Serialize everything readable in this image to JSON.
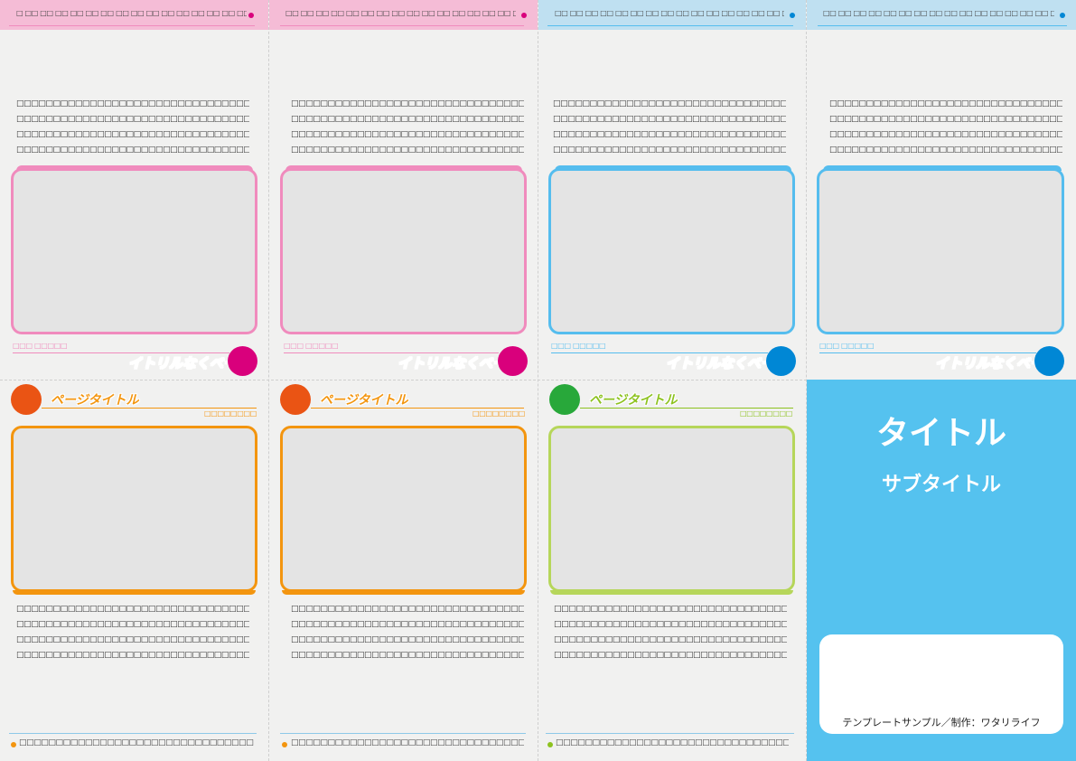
{
  "colors": {
    "pink": "#f08bbd",
    "pink_dark": "#d9007c",
    "blue": "#55bdee",
    "blue_dark": "#0087d5",
    "orange": "#f3950f",
    "orange_dark": "#ea5414",
    "green": "#b6d65a",
    "green_dark": "#28a83a",
    "cover": "#55c2ef"
  },
  "panels_top": [
    {
      "strip_text": "□ □□ □□ □□ □□ □□ □□ □□ □□ □□ □□ □□ □□ □□ □□ □□ □□ □□ □□ □□ □□",
      "para": [
        "□□□□□□□□□□□□□□□□□□□□□□□□□□□□□□□□□□□□",
        "□□□□□□□□□□□□□□□□□□□□□□□□□□□□□□□□□□□□",
        "□□□□□□□□□□□□□□□□□□□□□□□□□□□□□□□□□□□□",
        "□□□□□□□□□□□□□□□□□□□□□□□□□□□□□□□□□□□□"
      ],
      "caption": "□□□ □□□□□",
      "stylized": "イトリルなくべーし"
    },
    {
      "strip_text": "□□ □□ □□ □□ □□ □□ □□ □□ □□ □□ □□ □□ □□ □□ □□ □□ □□ □□ □□ □□",
      "para": [
        "□□□□□□□□□□□□□□□□□□□□□□□□□□□□□□□□□□□□",
        "□□□□□□□□□□□□□□□□□□□□□□□□□□□□□□□□□□□□",
        "□□□□□□□□□□□□□□□□□□□□□□□□□□□□□□□□□□□□",
        "□□□□□□□□□□□□□□□□□□□□□□□□□□□□□□□□□□□□"
      ],
      "caption": "□□□ □□□□□",
      "stylized": "イトリルなくべーし"
    },
    {
      "strip_text": "□□ □□ □□ □□ □□ □□ □□ □□ □□ □□ □□ □□ □□ □□ □□ □□ □□ □□ □□ □□",
      "para": [
        "□□□□□□□□□□□□□□□□□□□□□□□□□□□□□□□□□□□□",
        "□□□□□□□□□□□□□□□□□□□□□□□□□□□□□□□□□□□□",
        "□□□□□□□□□□□□□□□□□□□□□□□□□□□□□□□□□□□□",
        "□□□□□□□□□□□□□□□□□□□□□□□□□□□□□□□□□□□□"
      ],
      "caption": "□□□ □□□□□",
      "stylized": "イトリルなくべーし"
    },
    {
      "strip_text": "□□ □□ □□ □□ □□ □□ □□ □□ □□ □□ □□ □□ □□ □□ □□ □□ □□ □□ □□ □□",
      "para": [
        "□□□□□□□□□□□□□□□□□□□□□□□□□□□□□□□□□□□□",
        "□□□□□□□□□□□□□□□□□□□□□□□□□□□□□□□□□□□□",
        "□□□□□□□□□□□□□□□□□□□□□□□□□□□□□□□□□□□□",
        "□□□□□□□□□□□□□□□□□□□□□□□□□□□□□□□□□□□□"
      ],
      "caption": "□□□ □□□□□",
      "stylized": "イトリルなくべーし"
    }
  ],
  "panels_bottom": [
    {
      "title": "ページタイトル",
      "subcaption": "□□□□□□□□",
      "para": [
        "□□□□□□□□□□□□□□□□□□□□□□□□□□□□□□□□□□□□",
        "□□□□□□□□□□□□□□□□□□□□□□□□□□□□□□□□□□□□",
        "□□□□□□□□□□□□□□□□□□□□□□□□□□□□□□□□□□□□",
        "□□□□□□□□□□□□□□□□□□□□□□□□□□□□□□□□□□□□"
      ],
      "footer": "□□□□□□□□□□□□□□□□□□□□□□□□□□□□□□□□□□□□□□□□□□"
    },
    {
      "title": "ページタイトル",
      "subcaption": "□□□□□□□□",
      "para": [
        "□□□□□□□□□□□□□□□□□□□□□□□□□□□□□□□□□□□□",
        "□□□□□□□□□□□□□□□□□□□□□□□□□□□□□□□□□□□□",
        "□□□□□□□□□□□□□□□□□□□□□□□□□□□□□□□□□□□□",
        "□□□□□□□□□□□□□□□□□□□□□□□□□□□□□□□□□□□□"
      ],
      "footer": "□□□□□□□□□□□□□□□□□□□□□□□□□□□□□□□□□□□□□□□□□□"
    },
    {
      "title": "ページタイトル",
      "subcaption": "□□□□□□□□",
      "para": [
        "□□□□□□□□□□□□□□□□□□□□□□□□□□□□□□□□□□□□",
        "□□□□□□□□□□□□□□□□□□□□□□□□□□□□□□□□□□□□",
        "□□□□□□□□□□□□□□□□□□□□□□□□□□□□□□□□□□□□",
        "□□□□□□□□□□□□□□□□□□□□□□□□□□□□□□□□□□□□"
      ],
      "footer": "□□□□□□□□□□□□□□□□□□□□□□□□□□□□□□□□□□□□□□□□□□"
    }
  ],
  "cover": {
    "title": "タイトル",
    "subtitle": "サブタイトル",
    "credit": "テンプレートサンプル／制作：ワタリライフ"
  }
}
